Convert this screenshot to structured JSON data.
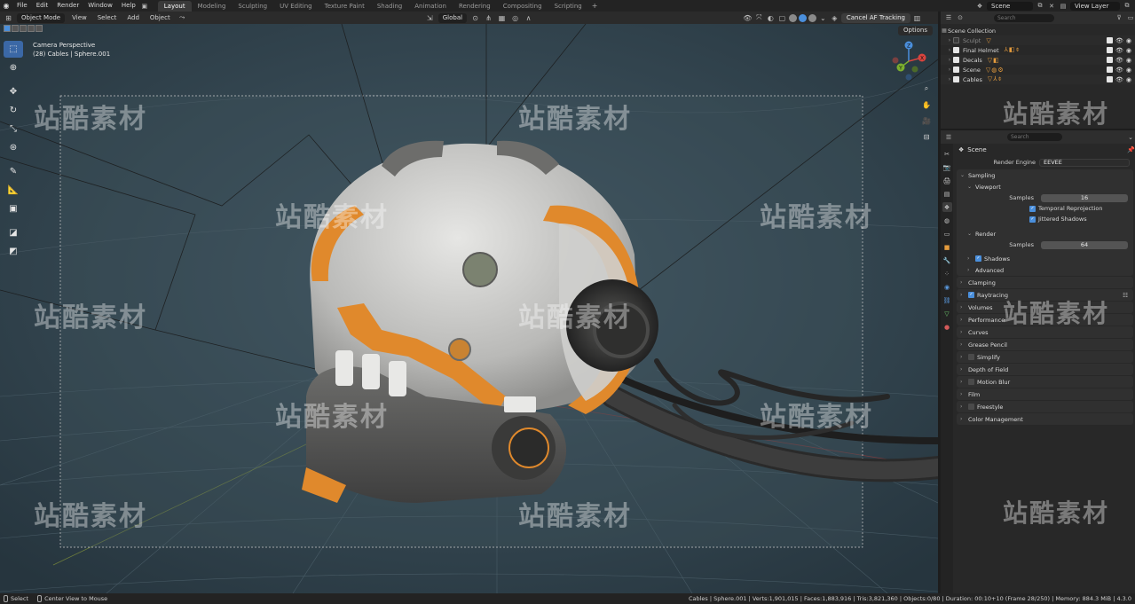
{
  "menu": {
    "items": [
      "File",
      "Edit",
      "Render",
      "Window",
      "Help"
    ],
    "workspaces": [
      "Layout",
      "Modeling",
      "Sculpting",
      "UV Editing",
      "Texture Paint",
      "Shading",
      "Animation",
      "Rendering",
      "Compositing",
      "Scripting"
    ],
    "active_workspace": "Layout",
    "add_tab": "+",
    "scene_name": "Scene",
    "view_layer": "View Layer"
  },
  "viewport_header": {
    "mode": "Object Mode",
    "menus": [
      "View",
      "Select",
      "Add",
      "Object"
    ],
    "transform_orientation": "Global",
    "cancel_af": "Cancel AF Tracking",
    "options": "Options"
  },
  "viewport": {
    "perspective": "Camera Perspective",
    "object_info": "(28) Cables | Sphere.001",
    "gizmo": {
      "z": "Z",
      "y": "Y",
      "x": "X"
    }
  },
  "watermark": "站酷素材",
  "statusbar": {
    "select": "Select",
    "center_view": "Center View to Mouse",
    "stats": "Cables | Sphere.001 | Verts:1,901,015 | Faces:1,883,916 | Tris:3,821,360 | Objects:0/80 | Duration: 00:10+10 (Frame 28/250) | Memory: 884.3 MiB | 4.3.0"
  },
  "outliner": {
    "search_placeholder": "Search",
    "root": "Scene Collection",
    "collections": [
      {
        "name": "Sculpt",
        "dim": true
      },
      {
        "name": "Final Helmet",
        "dim": false
      },
      {
        "name": "Decals",
        "dim": false
      },
      {
        "name": "Scene",
        "dim": false
      },
      {
        "name": "Cables",
        "dim": false
      }
    ]
  },
  "properties": {
    "search_placeholder": "Search",
    "context": "Scene",
    "render_engine_label": "Render Engine",
    "render_engine": "EEVEE",
    "sampling": "Sampling",
    "viewport_section": "Viewport",
    "samples_label": "Samples",
    "viewport_samples": "16",
    "temporal_reprojection": "Temporal Reprojection",
    "jittered_shadows": "Jittered Shadows",
    "render_section": "Render",
    "render_samples": "64",
    "shadows": "Shadows",
    "advanced": "Advanced",
    "panels": [
      "Clamping",
      "Raytracing",
      "Volumes",
      "Performance",
      "Curves",
      "Grease Pencil",
      "Simplify",
      "Depth of Field",
      "Motion Blur",
      "Film",
      "Freestyle",
      "Color Management"
    ]
  },
  "colors": {
    "accent": "#4a8fdc",
    "viewport_bg": "#2c3d47",
    "helmet_orange": "#e0892c",
    "helmet_shell": "#c9c9c7"
  }
}
